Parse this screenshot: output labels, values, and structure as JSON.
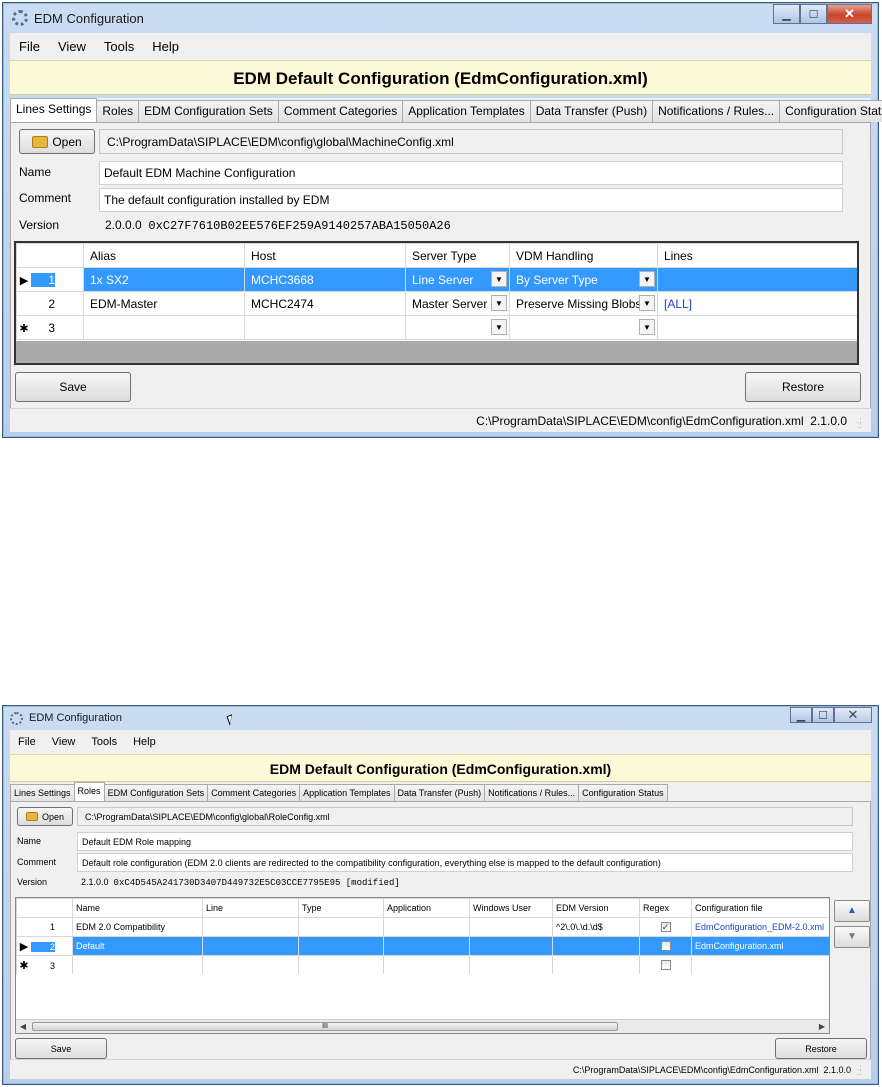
{
  "window1": {
    "title": "EDM Configuration",
    "menu": [
      "File",
      "View",
      "Tools",
      "Help"
    ],
    "header": "EDM Default Configuration (EdmConfiguration.xml)",
    "tabs": [
      "Lines Settings",
      "Roles",
      "EDM Configuration Sets",
      "Comment Categories",
      "Application Templates",
      "Data Transfer (Push)",
      "Notifications / Rules...",
      "Configuration Status"
    ],
    "active_tab": "Lines Settings",
    "open_label": "Open",
    "file_path": "C:\\ProgramData\\SIPLACE\\EDM\\config\\global\\MachineConfig.xml",
    "name_label": "Name",
    "name_value": "Default EDM Machine Configuration",
    "comment_label": "Comment",
    "comment_value": "The default configuration installed by EDM",
    "version_label": "Version",
    "version_value": "2.0.0.0",
    "version_hash": "0xC27F7610B02EE576EF259A9140257ABA15050A26",
    "columns": [
      "Alias",
      "Host",
      "Server Type",
      "VDM Handling",
      "Lines"
    ],
    "rows": [
      {
        "num": "1",
        "marker": "▶",
        "alias": "1x SX2",
        "host": "MCHC3668",
        "server_type": "Line Server",
        "vdm": "By Server Type",
        "lines": ""
      },
      {
        "num": "2",
        "marker": "",
        "alias": "EDM-Master",
        "host": "MCHC2474",
        "server_type": "Master Server",
        "vdm": "Preserve Missing Blobs",
        "lines": "[ALL]"
      },
      {
        "num": "3",
        "marker": "✱",
        "alias": "",
        "host": "",
        "server_type": "",
        "vdm": "",
        "lines": ""
      }
    ],
    "save_label": "Save",
    "restore_label": "Restore",
    "status_path": "C:\\ProgramData\\SIPLACE\\EDM\\config\\EdmConfiguration.xml",
    "status_version": "2.1.0.0"
  },
  "window2": {
    "title": "EDM Configuration",
    "menu": [
      "File",
      "View",
      "Tools",
      "Help"
    ],
    "header": "EDM Default Configuration (EdmConfiguration.xml)",
    "tabs": [
      "Lines Settings",
      "Roles",
      "EDM Configuration Sets",
      "Comment Categories",
      "Application Templates",
      "Data Transfer (Push)",
      "Notifications / Rules...",
      "Configuration Status"
    ],
    "active_tab": "Roles",
    "open_label": "Open",
    "file_path": "C:\\ProgramData\\SIPLACE\\EDM\\config\\global\\RoleConfig.xml",
    "name_label": "Name",
    "name_value": "Default EDM Role mapping",
    "comment_label": "Comment",
    "comment_value": "Default role configuration (EDM 2.0 clients are redirected to the compatibility configuration, everything else is mapped to the default configuration)",
    "version_label": "Version",
    "version_value": "2.1.0.0",
    "version_hash": "0xC4D545A241730D3407D449732E5C03CCE7795E95 [modified]",
    "columns": [
      "Name",
      "Line",
      "Type",
      "Application",
      "Windows User",
      "EDM Version",
      "Regex",
      "Configuration file"
    ],
    "rows": [
      {
        "num": "1",
        "marker": "",
        "name": "EDM 2.0 Compatibility",
        "line": "",
        "type": "",
        "application": "",
        "windows_user": "",
        "edm_version": "^2\\.0\\.\\d.\\d$",
        "regex": true,
        "config_file": "EdmConfiguration_EDM-2.0.xml"
      },
      {
        "num": "2",
        "marker": "▶",
        "name": "Default",
        "line": "",
        "type": "",
        "application": "",
        "windows_user": "",
        "edm_version": "",
        "regex": false,
        "config_file": "EdmConfiguration.xml"
      },
      {
        "num": "3",
        "marker": "✱",
        "name": "",
        "line": "",
        "type": "",
        "application": "",
        "windows_user": "",
        "edm_version": "",
        "regex": false,
        "config_file": ""
      }
    ],
    "scroll_thumb_label": "III",
    "save_label": "Save",
    "restore_label": "Restore",
    "status_path": "C:\\ProgramData\\SIPLACE\\EDM\\config\\EdmConfiguration.xml",
    "status_version": "2.1.0.0"
  },
  "colors": {
    "selection": "#3399ff",
    "header_band": "#fcf9d8",
    "link": "#1a46c8"
  },
  "icons": {
    "app": "edm-app-icon",
    "open": "folder-open-icon",
    "row_current": "triangle-right-icon",
    "row_new": "asterisk-icon",
    "move_up": "arrow-up-icon",
    "move_down": "arrow-down-icon"
  }
}
